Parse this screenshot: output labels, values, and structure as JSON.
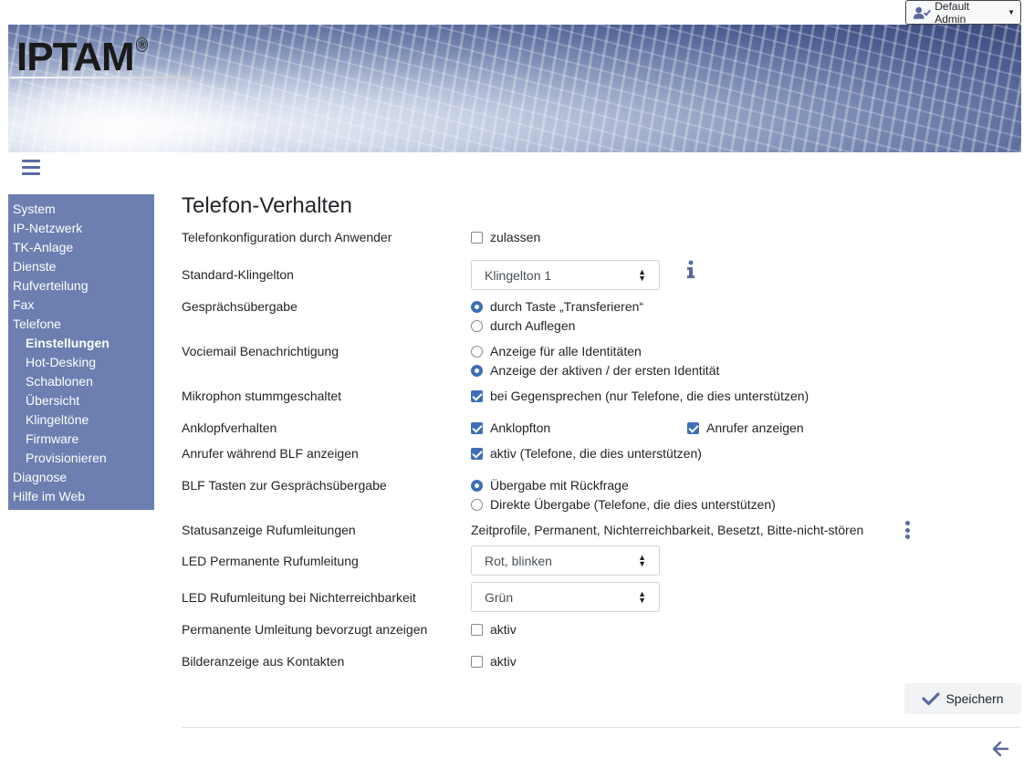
{
  "user_menu": {
    "label": "Default Admin"
  },
  "logo": {
    "text": "IPTAM",
    "reg": "®"
  },
  "sidebar": {
    "items": [
      {
        "label": "System",
        "level": 0
      },
      {
        "label": "IP-Netzwerk",
        "level": 0
      },
      {
        "label": "TK-Anlage",
        "level": 0
      },
      {
        "label": "Dienste",
        "level": 0
      },
      {
        "label": "Rufverteilung",
        "level": 0
      },
      {
        "label": "Fax",
        "level": 0
      },
      {
        "label": "Telefone",
        "level": 0
      },
      {
        "label": "Einstellungen",
        "level": 1,
        "active": true
      },
      {
        "label": "Hot-Desking",
        "level": 1
      },
      {
        "label": "Schablonen",
        "level": 1
      },
      {
        "label": "Übersicht",
        "level": 1
      },
      {
        "label": "Klingeltöne",
        "level": 1
      },
      {
        "label": "Firmware",
        "level": 1
      },
      {
        "label": "Provisionieren",
        "level": 1
      },
      {
        "label": "Diagnose",
        "level": 0
      },
      {
        "label": "Hilfe im Web",
        "level": 0
      }
    ]
  },
  "page": {
    "title": "Telefon-Verhalten",
    "rows": {
      "config_by_user": {
        "label": "Telefonkonfiguration durch Anwender",
        "option": "zulassen",
        "checked": false
      },
      "ringtone": {
        "label": "Standard-Klingelton",
        "value": "Klingelton 1"
      },
      "transfer": {
        "label": "Gesprächsübergabe",
        "options": [
          "durch Taste „Transferieren“",
          "durch Auflegen"
        ],
        "selected": 0
      },
      "voicemail": {
        "label": "Vociemail Benachrichtigung",
        "options": [
          "Anzeige für alle Identitäten",
          "Anzeige der aktiven / der ersten Identität"
        ],
        "selected": 1
      },
      "mic_muted": {
        "label": "Mikrophon stummgeschaltet",
        "option": "bei Gegensprechen (nur Telefone, die dies unterstützen)",
        "checked": true
      },
      "call_waiting": {
        "label": "Anklopfverhalten",
        "option1": "Anklopfton",
        "option1_checked": true,
        "option2": "Anrufer anzeigen",
        "option2_checked": true
      },
      "blf_caller": {
        "label": "Anrufer während BLF anzeigen",
        "option": "aktiv (Telefone, die dies unterstützen)",
        "checked": true
      },
      "blf_transfer": {
        "label": "BLF Tasten zur Gesprächsübergabe",
        "options": [
          "Übergabe mit Rückfrage",
          "Direkte Übergabe (Telefone, die dies unterstützen)"
        ],
        "selected": 0
      },
      "status_forward": {
        "label": "Statusanzeige Rufumleitungen",
        "value": "Zeitprofile, Permanent, Nichterreichbarkeit, Besetzt, Bitte-nicht-stören"
      },
      "led_permanent": {
        "label": "LED Permanente Rufumleitung",
        "value": "Rot, blinken"
      },
      "led_unreachable": {
        "label": "LED Rufumleitung bei Nichterreichbarkeit",
        "value": "Grün"
      },
      "permanent_pref": {
        "label": "Permanente Umleitung bevorzugt anzeigen",
        "option": "aktiv",
        "checked": false
      },
      "contact_images": {
        "label": "Bilderanzeige aus Kontakten",
        "option": "aktiv",
        "checked": false
      }
    },
    "save_label": "Speichern"
  },
  "colors": {
    "accent": "#3d6fb6",
    "sidebar_bg": "#6c7fb0",
    "icon": "#5a6aa0"
  }
}
